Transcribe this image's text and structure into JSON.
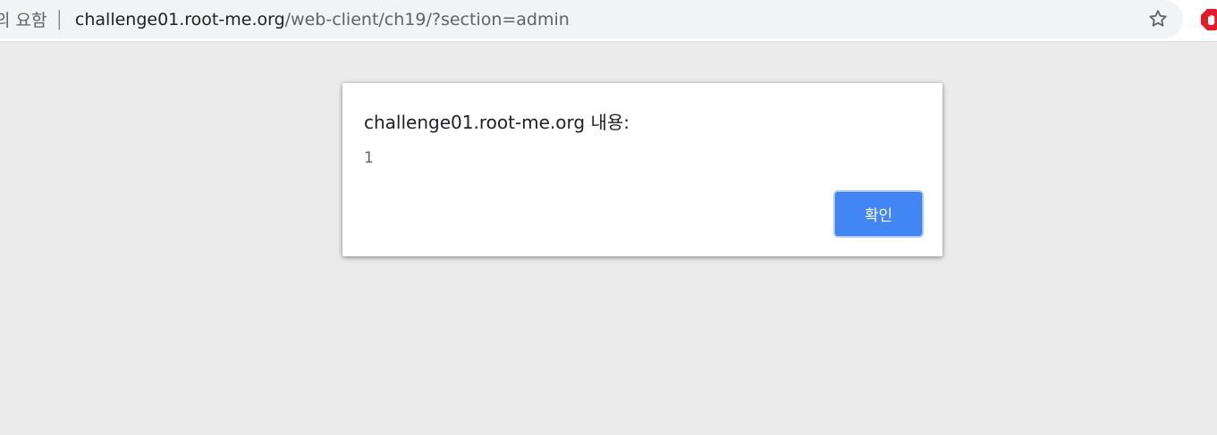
{
  "browser": {
    "security_label": "의 요함",
    "separator": "|",
    "url_host": "challenge01.root-me.org",
    "url_path": "/web-client/ch19/?section=admin",
    "star_icon": "star-icon",
    "extension_icon": "extension-icon",
    "extension_color": "#e11d2a"
  },
  "alert": {
    "title": "challenge01.root-me.org 내용:",
    "message": "1",
    "ok_label": "확인",
    "button_color": "#4285f4"
  }
}
